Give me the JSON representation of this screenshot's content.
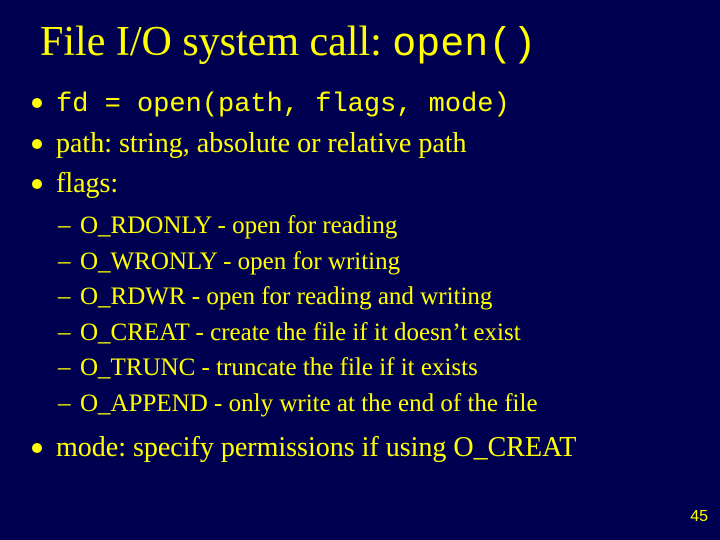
{
  "title": {
    "prefix": "File I/O system call: ",
    "mono": "open()"
  },
  "bullets": {
    "b0_mono": "fd = open(path, flags, mode)",
    "b1": "path: string, absolute or relative path",
    "b2": "flags:",
    "b3": "mode: specify permissions if using O_CREAT"
  },
  "flags": {
    "f0": "O_RDONLY - open for reading",
    "f1": "O_WRONLY - open for writing",
    "f2": "O_RDWR - open for reading and writing",
    "f3": "O_CREAT - create the file if it doesn’t exist",
    "f4": "O_TRUNC - truncate the file if it exists",
    "f5": "O_APPEND - only write at the end of the file"
  },
  "page_number": "45"
}
